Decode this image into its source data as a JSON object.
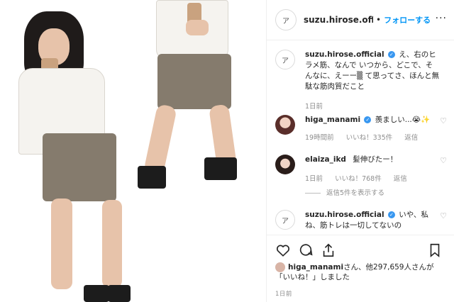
{
  "post": {
    "photo_alt": "",
    "header": {
      "username": "suzu.hirose.offici",
      "separator": "•",
      "follow_label": "フォローする",
      "more_label": "···"
    },
    "comments": [
      {
        "username": "suzu.hirose.official",
        "verified": true,
        "text": "え、右のヒラメ筋、なんで いつから、どこで、そんなに、えーー▒ て思ってさ、ほんと無駄な筋肉質だこと",
        "time": "1日前"
      },
      {
        "username": "higa_manami",
        "verified": true,
        "text": "羨ましい...😭✨",
        "time": "19時間前",
        "likes": "いいね！335件",
        "reply": "返信"
      },
      {
        "username": "elaiza_ikd",
        "verified": false,
        "text": "髪伸びたー！",
        "time": "1日前",
        "likes": "いいね！768件",
        "reply": "返信",
        "view_replies": "返信5件を表示する"
      },
      {
        "username": "suzu.hirose.official",
        "verified": true,
        "text": "いや、私ね、筋トレは一切してないの"
      }
    ],
    "likes_line": {
      "user": "higa_manami",
      "rest": "さん、他297,659人さんが「いいね！」しました"
    },
    "date": "1日前"
  },
  "colors": {
    "accent": "#0095f6",
    "verified": "#3897f0",
    "muted": "#8e8e8e",
    "text": "#262626"
  },
  "icons": [
    "heart-icon",
    "comment-icon",
    "share-icon",
    "bookmark-icon",
    "more-icon",
    "verified-icon"
  ]
}
